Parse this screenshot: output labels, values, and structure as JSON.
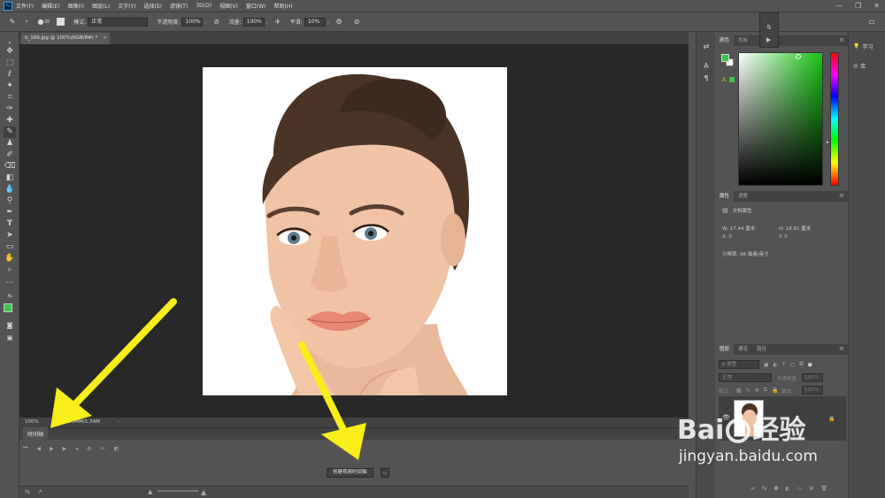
{
  "app": {
    "logo": "Ps"
  },
  "menu": [
    "文件(F)",
    "编辑(E)",
    "图像(I)",
    "图层(L)",
    "文字(Y)",
    "选择(S)",
    "滤镜(T)",
    "3D(D)",
    "视图(V)",
    "窗口(W)",
    "帮助(H)"
  ],
  "window_controls": {
    "minimize": "—",
    "restore": "❐",
    "close": "✕"
  },
  "options": {
    "brush_size": "30",
    "mode_label": "模式:",
    "mode_value": "正常",
    "opacity_label": "不透明度:",
    "opacity_value": "100%",
    "flow_label": "流量:",
    "flow_value": "100%",
    "smooth_label": "平滑:",
    "smooth_value": "10%"
  },
  "document": {
    "tab_title": "b_169.jpg @ 100%(RGB/8#) *",
    "close": "×",
    "zoom": "100%",
    "doc_size": "文档:1.34M/1.34M"
  },
  "timeline": {
    "tab_label": "时间轴",
    "create_button": "创建视频时间轴",
    "dropdown": "⌵"
  },
  "color_panel": {
    "tabs": [
      "颜色",
      "色板"
    ]
  },
  "props_panel": {
    "tabs": [
      "属性",
      "调整"
    ],
    "section": "文档属性",
    "w_label": "W:",
    "w_value": "17.44 厘米",
    "h_label": "H:",
    "h_value": "18.81 厘米",
    "x_label": "X:",
    "x_value": "0",
    "y_label": "Y:",
    "y_value": "0",
    "resolution": "分辨率: 96 像素/英寸"
  },
  "layers_panel": {
    "tabs": [
      "图层",
      "通道",
      "路径"
    ],
    "kind_label": "ρ 类型",
    "blend_mode": "正常",
    "opacity_label": "不透明度:",
    "opacity_value": "100%",
    "lock_label": "锁定:",
    "fill_label": "填充:",
    "fill_value": "100%"
  },
  "far_right": {
    "learn": "学习",
    "library": "库"
  },
  "watermark": {
    "brand_left": "Bai",
    "brand_right": "经验",
    "url": "jingyan.baidu.com"
  },
  "colors": {
    "foreground": "#3ec44a",
    "background": "#ffffff",
    "arrow": "#f7ee1a"
  }
}
